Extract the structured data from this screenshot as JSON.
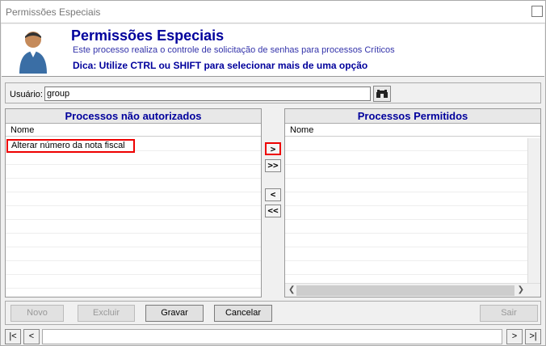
{
  "window": {
    "title": "Permissões Especiais"
  },
  "header": {
    "title": "Permissões Especiais",
    "subtitle": "Este processo realiza o controle de solicitação de senhas para processos Críticos",
    "tip": "Dica: Utilize CTRL ou SHIFT para selecionar mais de uma opção"
  },
  "user": {
    "label": "Usuário:",
    "value": "group"
  },
  "left_panel": {
    "title": "Processos não autorizados",
    "column": "Nome",
    "items": [
      "Alterar número da nota fiscal"
    ]
  },
  "right_panel": {
    "title": "Processos Permitidos",
    "column": "Nome",
    "items": []
  },
  "transfer": {
    "move_one": ">",
    "move_all": ">>",
    "back_one": "<",
    "back_all": "<<"
  },
  "buttons": {
    "novo": "Novo",
    "excluir": "Excluir",
    "gravar": "Gravar",
    "cancelar": "Cancelar",
    "sair": "Sair"
  },
  "nav": {
    "first": "|<",
    "prev": "<",
    "next": ">",
    "last": ">|"
  },
  "colors": {
    "heading": "#00009c",
    "highlight": "#e00000"
  }
}
